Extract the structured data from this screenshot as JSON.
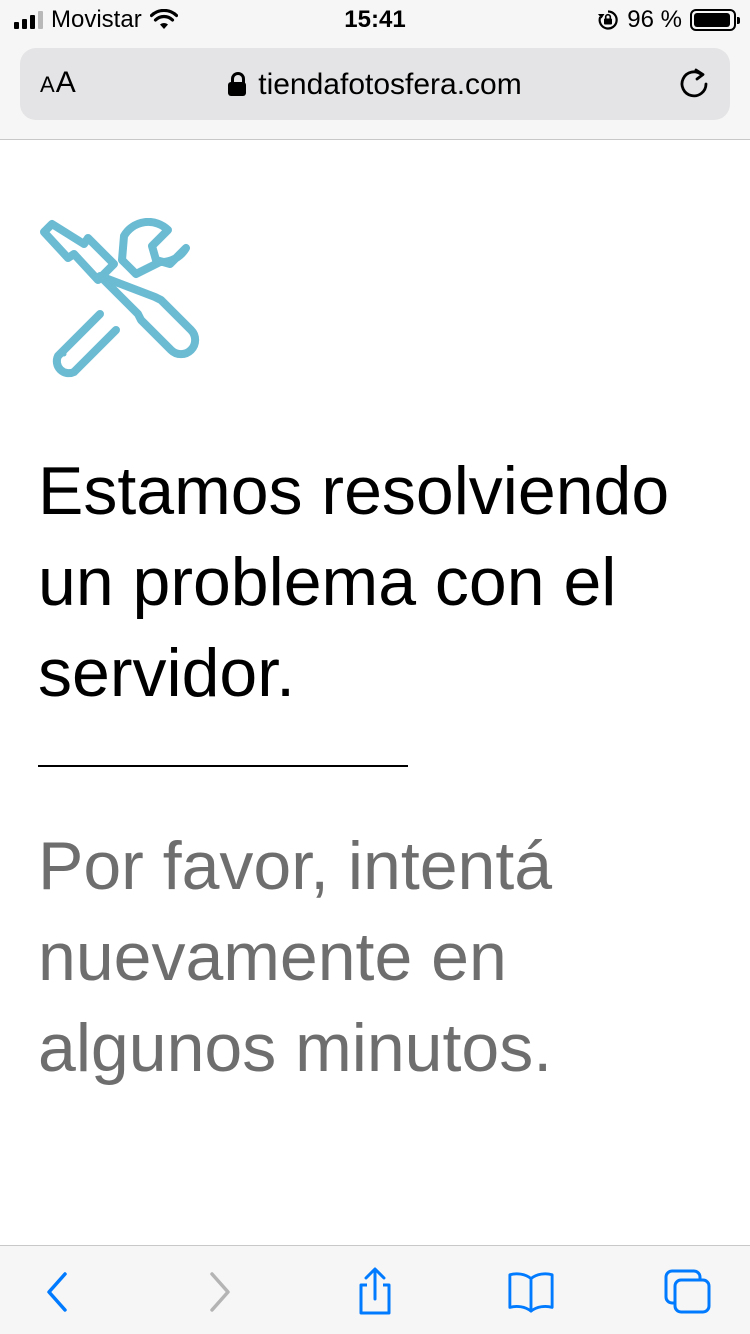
{
  "status_bar": {
    "carrier": "Movistar",
    "time": "15:41",
    "battery_percent": "96 %",
    "battery_level": 0.96,
    "signal_bars": 3,
    "icons": [
      "signal-icon",
      "wifi-icon",
      "rotation-lock-icon",
      "battery-icon"
    ]
  },
  "address_bar": {
    "text_size_label_small": "A",
    "text_size_label_large": "A",
    "url": "tiendafotosfera.com",
    "icons": [
      "lock-icon",
      "reload-icon"
    ]
  },
  "page": {
    "icon": "tools-icon",
    "headline": "Estamos resolviendo un problema con el servidor.",
    "subtext": "Por favor, intentá nuevamente en algunos minutos."
  },
  "toolbar": {
    "icons": [
      "back-icon",
      "forward-icon",
      "share-icon",
      "bookmarks-icon",
      "tabs-icon"
    ]
  },
  "colors": {
    "accent": "#007aff",
    "icon_teal": "#6bbbd3",
    "subtext_gray": "#6e6e6e",
    "disabled_gray": "#b4b4b4"
  }
}
